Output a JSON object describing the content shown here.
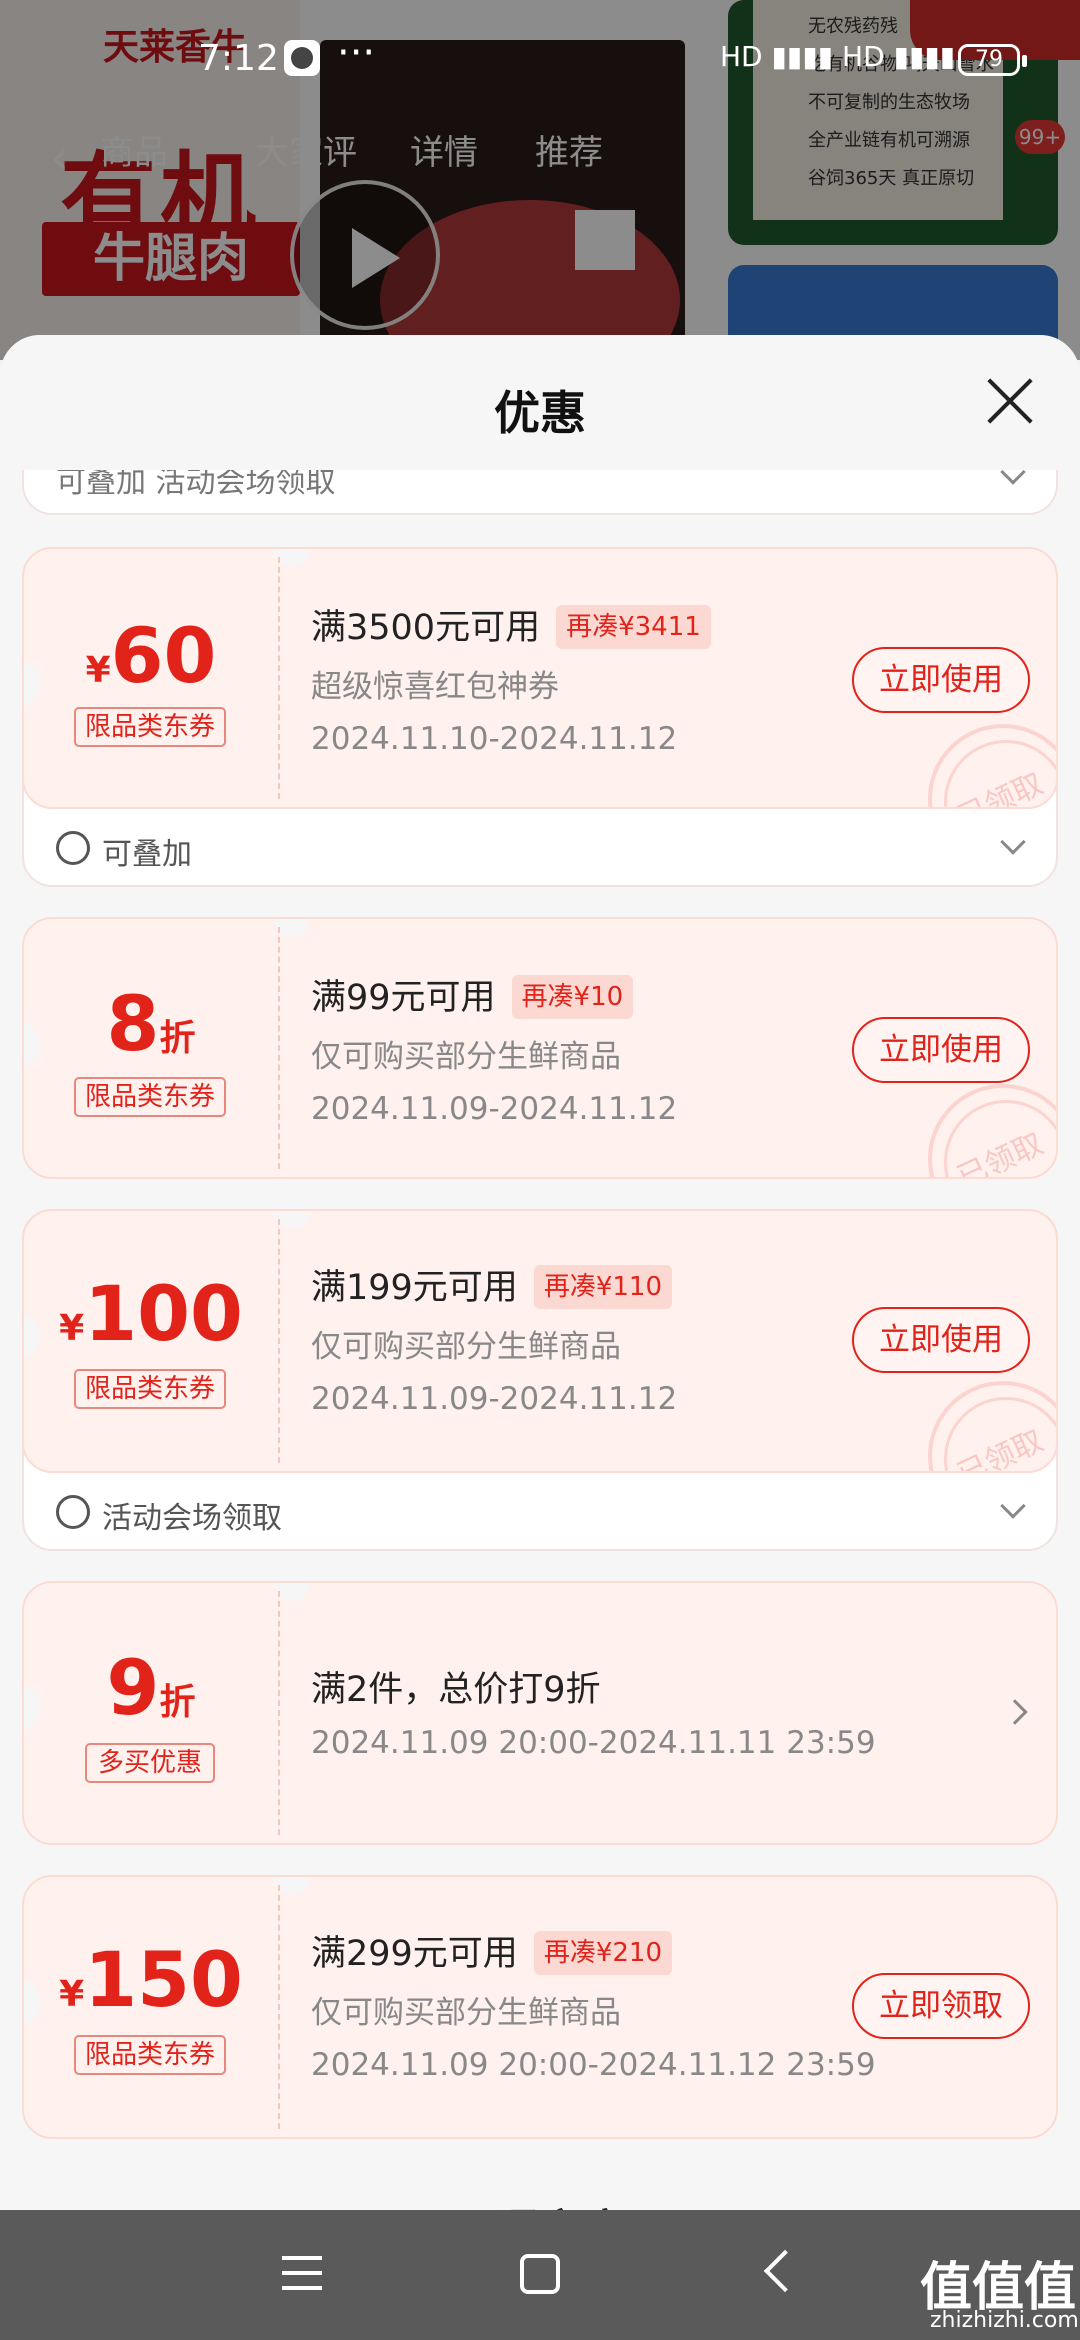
{
  "status_bar": {
    "time": "7:12",
    "more": "···",
    "battery": "79",
    "signal": "HD ▮▮▮▮ HD ▮▮▮▮"
  },
  "background": {
    "brand": "天莱香牛",
    "headline": "有机",
    "product": "牛腿肉",
    "nav_tabs": [
      "商品",
      "大家评",
      "详情",
      "推荐"
    ],
    "badge_count": "99+",
    "side_card_lines": [
      "无农残药残",
      "吃有机谷物 喝天山雪水",
      "不可复制的生态牧场",
      "全产业链有机可溯源",
      "谷饲365天 真正原切"
    ]
  },
  "sheet": {
    "title": "优惠",
    "top_group_text": "可叠加   活动会场领取",
    "bottom_cut_text": "开通京享",
    "coupons": [
      {
        "prefix": "¥",
        "amount": "60",
        "suffix": "",
        "type": "限品类东券",
        "condition": "满3500元可用",
        "chip": "再凑¥3411",
        "desc": "超级惊喜红包神券",
        "date": "2024.11.10-2024.11.12",
        "button": "立即使用",
        "stamp": "已领取",
        "group_footer": "可叠加"
      },
      {
        "prefix": "",
        "amount": "8",
        "suffix": "折",
        "type": "限品类东券",
        "condition": "满99元可用",
        "chip": "再凑¥10",
        "desc": "仅可购买部分生鲜商品",
        "date": "2024.11.09-2024.11.12",
        "button": "立即使用",
        "stamp": "已领取"
      },
      {
        "prefix": "¥",
        "amount": "100",
        "suffix": "",
        "type": "限品类东券",
        "condition": "满199元可用",
        "chip": "再凑¥110",
        "desc": "仅可购买部分生鲜商品",
        "date": "2024.11.09-2024.11.12",
        "button": "立即使用",
        "stamp": "已领取",
        "group_footer": "活动会场领取"
      },
      {
        "prefix": "",
        "amount": "9",
        "suffix": "折",
        "type": "多买优惠",
        "condition": "满2件，总价打9折",
        "chip": "",
        "desc": "",
        "date": "2024.11.09 20:00-2024.11.11 23:59",
        "button": ""
      },
      {
        "prefix": "¥",
        "amount": "150",
        "suffix": "",
        "type": "限品类东券",
        "condition": "满299元可用",
        "chip": "再凑¥210",
        "desc": "仅可购买部分生鲜商品",
        "date": "2024.11.09 20:00-2024.11.12 23:59",
        "button": "立即领取"
      }
    ]
  },
  "watermark": {
    "main": "值值值",
    "sub": "zhizhizhi.com"
  },
  "colors": {
    "accent": "#e2231a",
    "coupon_bg": "#fff1ee",
    "sheet_bg": "#f6f6f6"
  }
}
